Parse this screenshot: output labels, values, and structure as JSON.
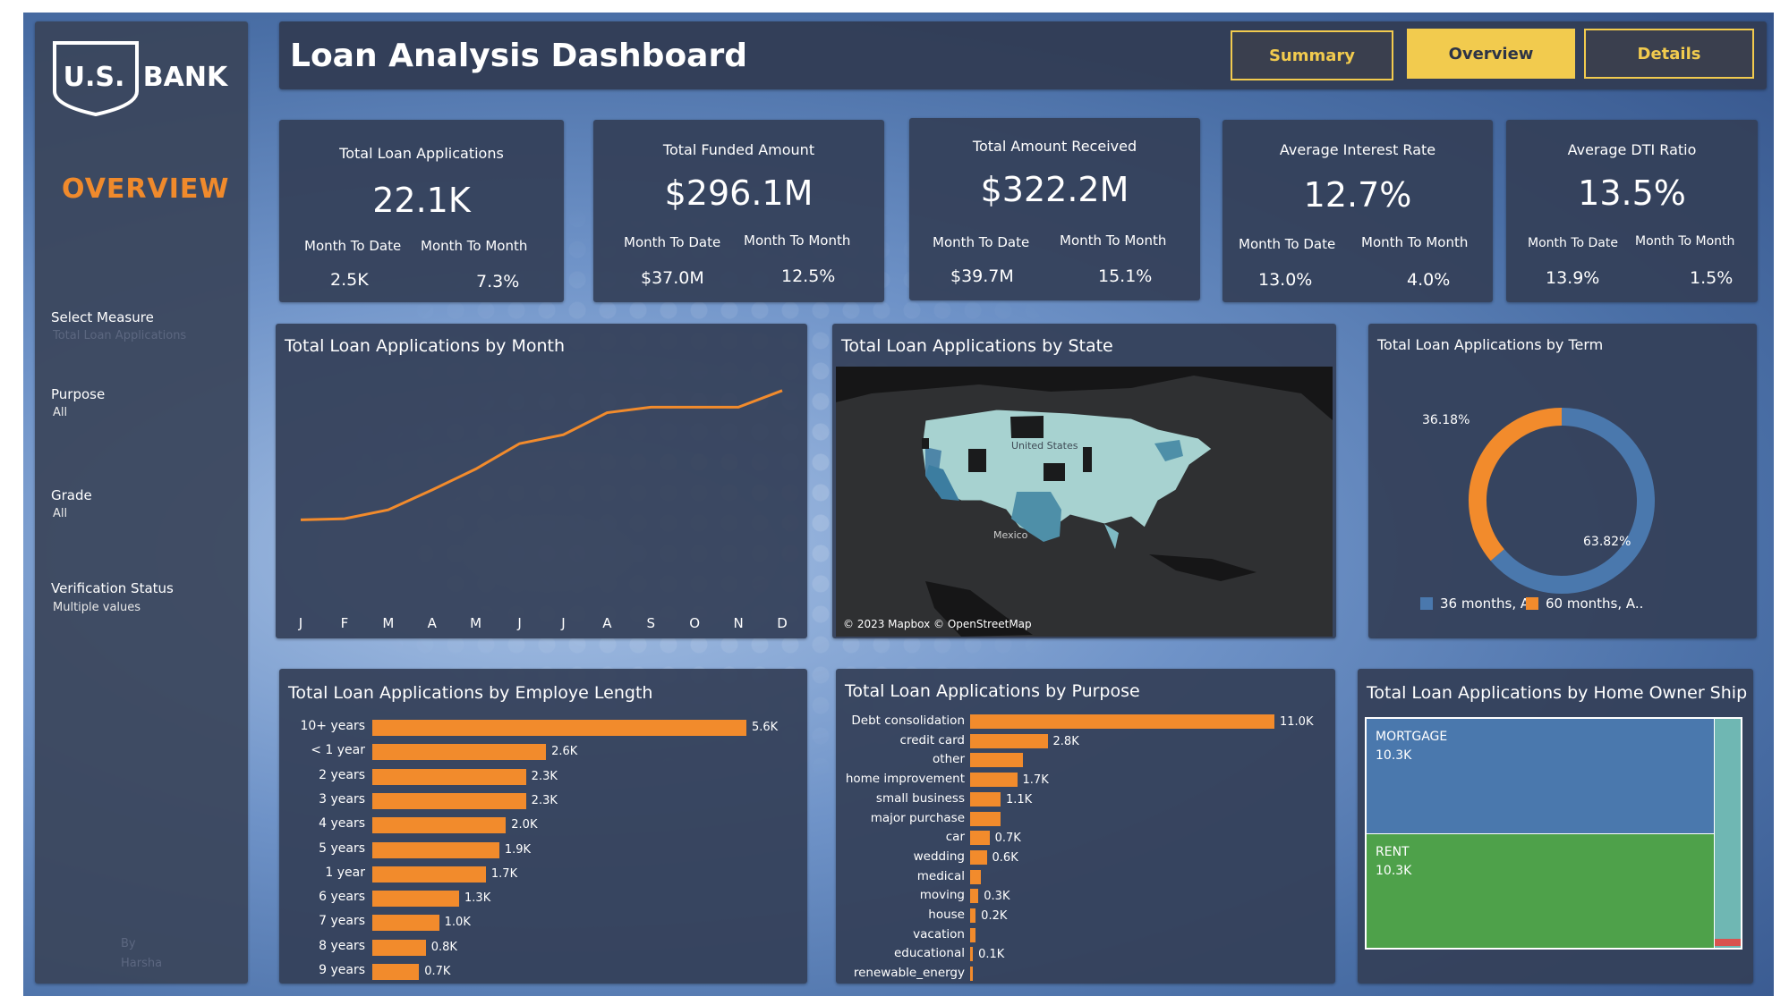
{
  "colors": {
    "accent_orange": "#f28b2c",
    "nav_gold": "#f2cb4e",
    "series_blue": "#4a78ad",
    "rent_green": "#4ea14a",
    "other_teal": "#6fb7b3"
  },
  "logo": {
    "text": "U.S. BANK"
  },
  "sidebar": {
    "title": "OVERVIEW",
    "filters": [
      {
        "label": "Select Measure",
        "value": "Total Loan Applications"
      },
      {
        "label": "Purpose",
        "value": "All"
      },
      {
        "label": "Grade",
        "value": "All"
      },
      {
        "label": "Verification Status",
        "value": "Multiple values"
      }
    ],
    "credit_by": "By",
    "credit_name": "Harsha"
  },
  "header": {
    "title": "Loan Analysis Dashboard",
    "nav": [
      {
        "label": "Summary",
        "active": false
      },
      {
        "label": "Overview",
        "active": true
      },
      {
        "label": "Details",
        "active": false
      }
    ]
  },
  "kpis": [
    {
      "label": "Total Loan Applications",
      "value": "22.1K",
      "mtd_label": "Month To Date",
      "mtd": "2.5K",
      "mom_label": "Month To Month",
      "mom": "7.3%"
    },
    {
      "label": "Total Funded Amount",
      "value": "$296.1M",
      "mtd_label": "Month To Date",
      "mtd": "$37.0M",
      "mom_label": "Month To Month",
      "mom": "12.5%"
    },
    {
      "label": "Total Amount Received",
      "value": "$322.2M",
      "mtd_label": "Month To Date",
      "mtd": "$39.7M",
      "mom_label": "Month To Month",
      "mom": "15.1%"
    },
    {
      "label": "Average Interest Rate",
      "value": "12.7%",
      "mtd_label": "Month To Date",
      "mtd": "13.0%",
      "mom_label": "Month To Month",
      "mom": "4.0%"
    },
    {
      "label": "Average DTI Ratio",
      "value": "13.5%",
      "mtd_label": "Month To Date",
      "mtd": "13.9%",
      "mom_label": "Month To Month",
      "mom": "1.5%"
    }
  ],
  "map": {
    "title": "Total Loan Applications by State",
    "labels": {
      "us": "United States",
      "mexico": "Mexico"
    },
    "attribution": "© 2023 Mapbox © OpenStreetMap"
  },
  "chart_data": [
    {
      "type": "line",
      "title": "Total Loan Applications by Month",
      "categories": [
        "J",
        "F",
        "M",
        "A",
        "M",
        "J",
        "J",
        "A",
        "S",
        "O",
        "N",
        "D"
      ],
      "values": [
        1.31,
        1.32,
        1.4,
        1.58,
        1.77,
        2.0,
        2.08,
        2.28,
        2.33,
        2.33,
        2.33,
        2.48
      ],
      "ylim": [
        0.9,
        2.6
      ],
      "grid": false
    },
    {
      "type": "pie",
      "title": "Total Loan Applications by Term",
      "labels": [
        "36 months, A..",
        "60 months, A.."
      ],
      "values": [
        63.82,
        36.18
      ],
      "value_labels": [
        "63.82%",
        "36.18%"
      ],
      "colors": [
        "#4a78ad",
        "#f28b2c"
      ],
      "legend": "bottom"
    },
    {
      "type": "bar",
      "title": "Total Loan Applications  by Employe Length",
      "categories": [
        "10+ years",
        "< 1 year",
        "2 years",
        "3 years",
        "4 years",
        "5 years",
        "1 year",
        "6 years",
        "7 years",
        "8 years",
        "9 years"
      ],
      "values": [
        5.6,
        2.6,
        2.3,
        2.3,
        2.0,
        1.9,
        1.7,
        1.3,
        1.0,
        0.8,
        0.7
      ],
      "value_labels": [
        "5.6K",
        "2.6K",
        "2.3K",
        "2.3K",
        "2.0K",
        "1.9K",
        "1.7K",
        "1.3K",
        "1.0K",
        "0.8K",
        "0.7K"
      ],
      "xlim": [
        0,
        5.6
      ]
    },
    {
      "type": "bar",
      "title": "Total Loan Applications  by Purpose",
      "categories": [
        "Debt consolidation",
        "credit card",
        "other",
        "home improvement",
        "small business",
        "major purchase",
        "car",
        "wedding",
        "medical",
        "moving",
        "house",
        "vacation",
        "educational",
        "renewable_energy"
      ],
      "values": [
        11.0,
        2.8,
        1.9,
        1.7,
        1.1,
        1.1,
        0.7,
        0.6,
        0.4,
        0.3,
        0.2,
        0.2,
        0.1,
        0.05
      ],
      "value_labels": [
        "11.0K",
        "2.8K",
        "",
        "1.7K",
        "1.1K",
        "",
        "0.7K",
        "0.6K",
        "",
        "0.3K",
        "0.2K",
        "",
        "0.1K",
        ""
      ],
      "xlim": [
        0,
        11.0
      ]
    },
    {
      "type": "treemap",
      "title": "Total Loan Applications by Home Owner Ship",
      "items": [
        {
          "label": "MORTGAGE",
          "value_text": "10.3K",
          "value": 10.3,
          "color": "#4a78ad"
        },
        {
          "label": "RENT",
          "value_text": "10.3K",
          "value": 10.3,
          "color": "#4ea14a"
        }
      ]
    }
  ]
}
